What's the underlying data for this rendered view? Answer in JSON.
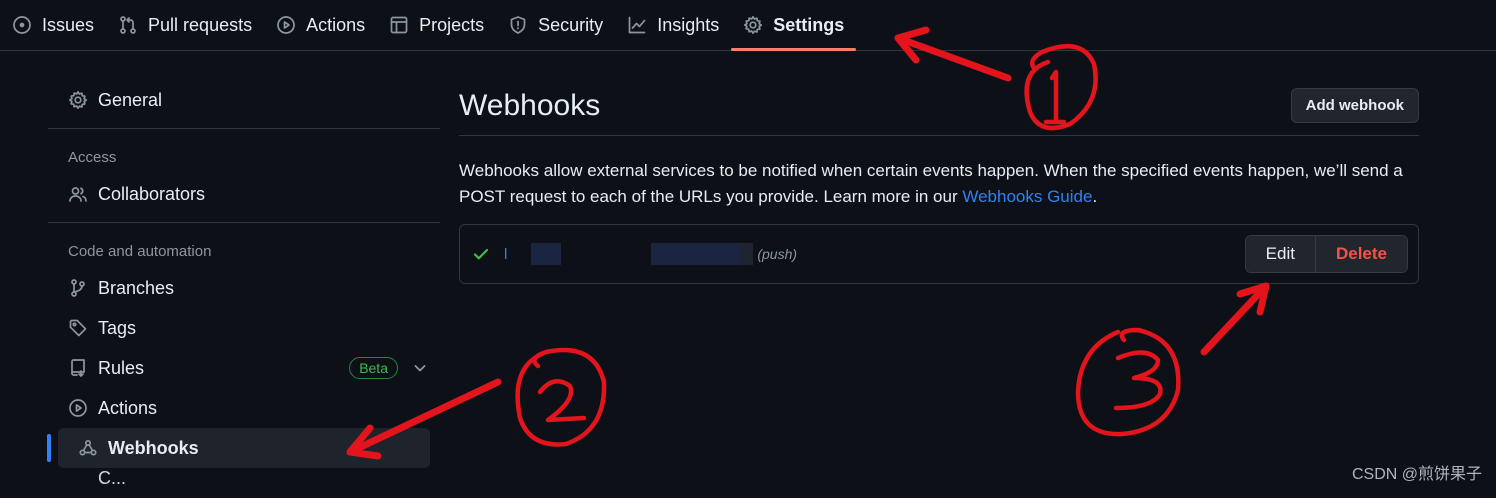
{
  "topnav": {
    "tabs": [
      {
        "label": "Issues",
        "icon": "issue-icon"
      },
      {
        "label": "Pull requests",
        "icon": "pull-request-icon"
      },
      {
        "label": "Actions",
        "icon": "play-icon"
      },
      {
        "label": "Projects",
        "icon": "table-icon"
      },
      {
        "label": "Security",
        "icon": "shield-icon"
      },
      {
        "label": "Insights",
        "icon": "graph-icon"
      },
      {
        "label": "Settings",
        "icon": "gear-icon",
        "active": true
      }
    ]
  },
  "sidebar": {
    "general": "General",
    "access_heading": "Access",
    "collaborators": "Collaborators",
    "code_heading": "Code and automation",
    "branches": "Branches",
    "tags": "Tags",
    "rules": "Rules",
    "rules_badge": "Beta",
    "actions": "Actions",
    "webhooks": "Webhooks",
    "next_partial": "C..."
  },
  "main": {
    "title": "Webhooks",
    "add_button": "Add webhook",
    "description": "Webhooks allow external services to be notified when certain events happen. When the specified events happen, we’ll send a POST request to each of the URLs you provide. Learn more in our ",
    "guide_link": "Webhooks Guide",
    "description_end": ".",
    "hook": {
      "url_prefix": "l",
      "event": "(push)",
      "edit_label": "Edit",
      "delete_label": "Delete"
    }
  },
  "annotations": {
    "marks": [
      "1",
      "2",
      "3"
    ]
  },
  "watermark": "CSDN @煎饼果子",
  "colors": {
    "background": "#0d1117",
    "accent_underline": "#f78166",
    "link": "#2f81f7",
    "danger": "#f85149",
    "success": "#3fb950",
    "annotation": "#e3141b"
  }
}
